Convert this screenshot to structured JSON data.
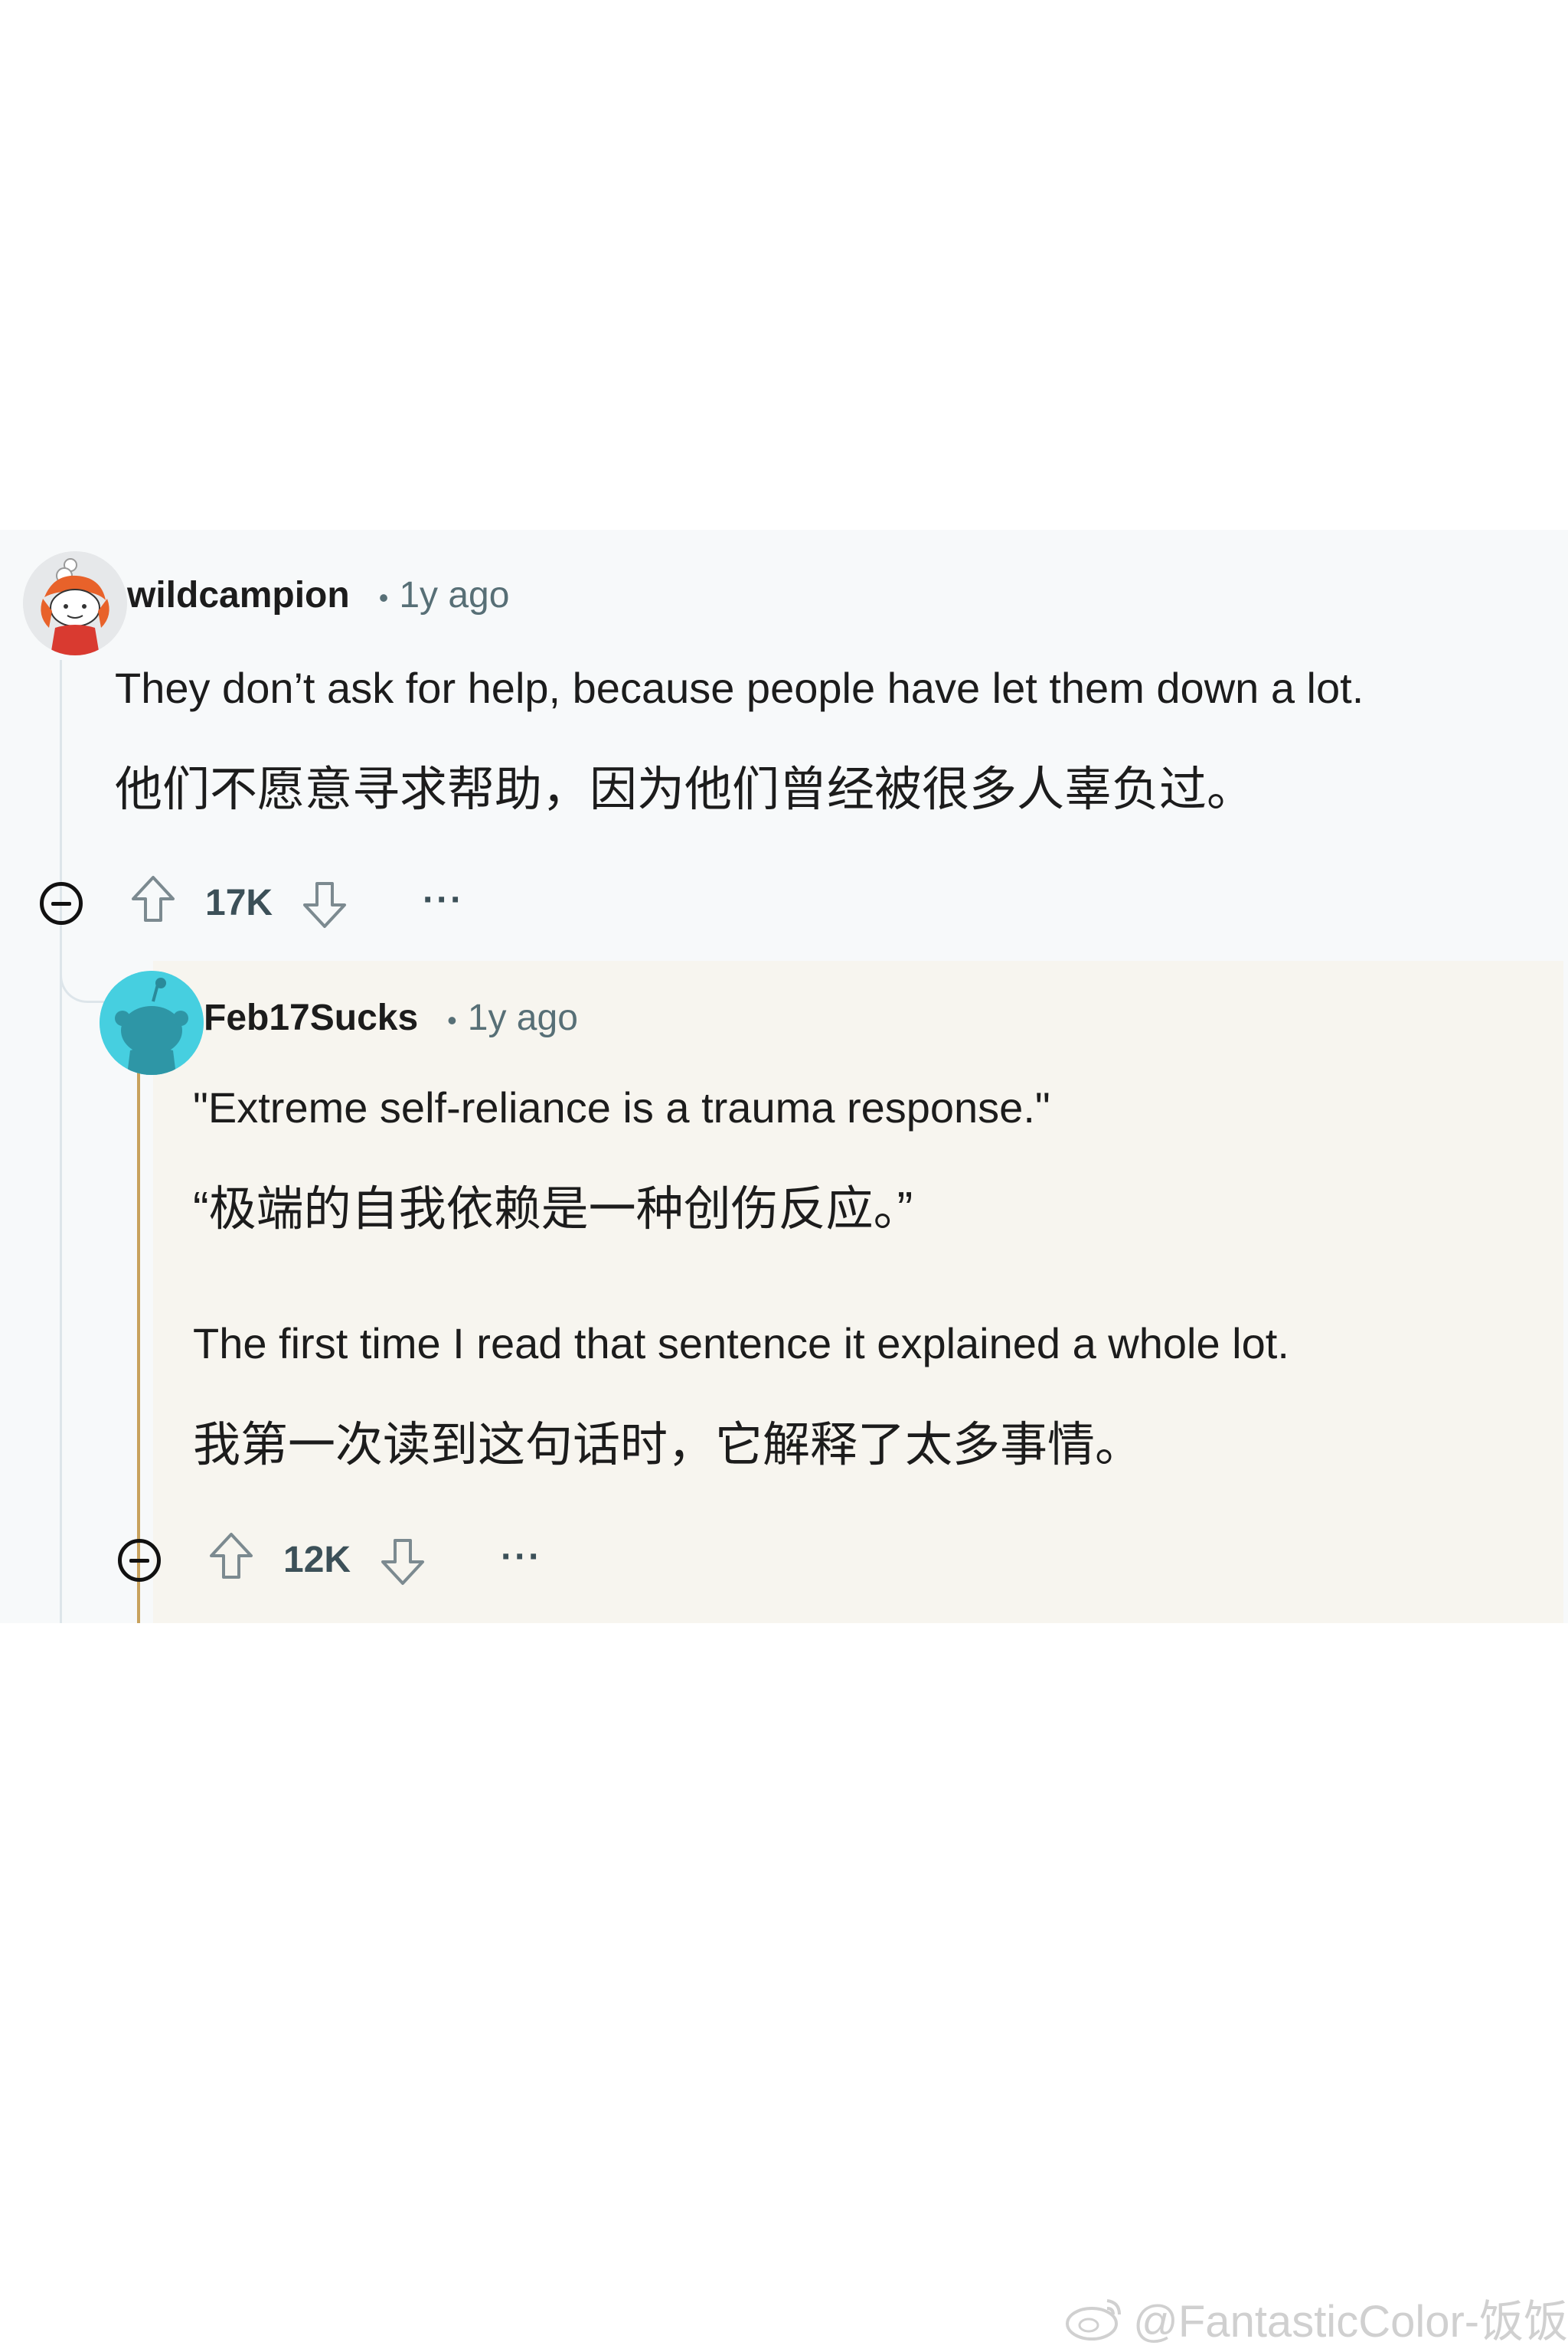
{
  "comment": {
    "username": "wildcampion",
    "time": "1y ago",
    "text_en": "They don’t ask for help, because people have let them down a lot.",
    "text_zh": "他们不愿意寻求帮助，因为他们曾经被很多人辜负过。",
    "votes": "17K",
    "more_label": "···"
  },
  "reply": {
    "username": "Feb17Sucks",
    "time": "1y ago",
    "quote_en": "\"Extreme self-reliance is a trauma response.\"",
    "quote_zh": "“极端的自我依赖是一种创伤反应。”",
    "text_en": "The first time I read that sentence it explained a whole lot.",
    "text_zh": "我第一次读到这句话时，它解释了太多事情。",
    "votes": "12K",
    "more_label": "···"
  },
  "meta": {
    "separator": "•"
  },
  "icons": {
    "collapse": "collapse-minus-icon",
    "upvote": "upvote-arrow-icon",
    "downvote": "downvote-arrow-icon",
    "more": "more-options-icon"
  },
  "colors": {
    "thread_bg": "#f7f9fa",
    "reply_bg": "#f7f5ef",
    "reply_line": "#c8a25d",
    "reply_avatar": "#46cfe0",
    "meta_text": "#576f76"
  },
  "watermark": {
    "text": "@FantasticColor-饭饭"
  }
}
